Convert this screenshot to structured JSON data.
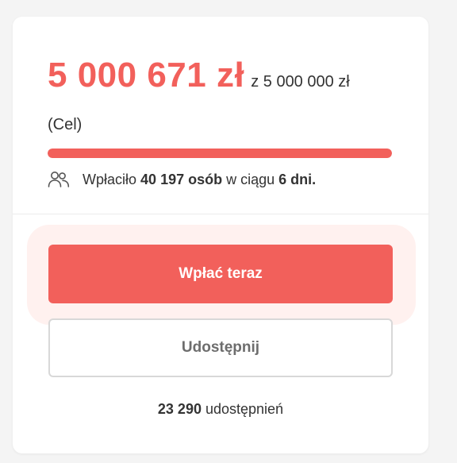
{
  "fundraiser": {
    "amount": "5 000 671 zł",
    "goal_prefix": "z 5 000 000 zł",
    "goal_suffix": "(Cel)",
    "progress_percent": 100,
    "donors_prefix": "Wpłaciło",
    "donors_count": "40 197 osób",
    "donors_middle": "w ciągu",
    "days": "6 dni."
  },
  "actions": {
    "donate_label": "Wpłać teraz",
    "share_label": "Udostępnij"
  },
  "shares": {
    "count": "23 290",
    "label": "udostępnień"
  },
  "colors": {
    "accent": "#f2605b",
    "glow": "#fff1ef"
  },
  "icons": {
    "donors": "people-icon"
  }
}
